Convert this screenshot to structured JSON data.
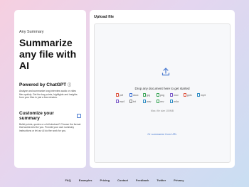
{
  "left": {
    "brand": "Any Summary",
    "hero": "Summarize any file with AI",
    "powered": {
      "title": "Powered by ChatGPT",
      "desc": "Analyze and summarize long interview audio or video files quickly. Get the key points, highlights and insights from your files in just a few minutes."
    },
    "customize": {
      "title": "Customize your summary",
      "desc": "Bullet points, quotes or a full abstract? Choose the format that works best for you. Provide your own summary instructions or let our AI do the work for you."
    }
  },
  "upload": {
    "title": "Upload file",
    "drop_text": "Drop any document here to get started",
    "max_size": "Max. file size 100MB",
    "url_link": "Or summarize from URL",
    "formats": [
      {
        "label": "pdf",
        "color": "#e0533d"
      },
      {
        "label": "docx",
        "color": "#3b6fd4"
      },
      {
        "label": "jpg",
        "color": "#3aa657"
      },
      {
        "label": "png",
        "color": "#3aa657"
      },
      {
        "label": "mov",
        "color": "#7a57c9"
      },
      {
        "label": "pptx",
        "color": "#e0533d"
      },
      {
        "label": "mp3",
        "color": "#2b8cc4"
      },
      {
        "label": "mp4",
        "color": "#7a57c9"
      },
      {
        "label": "txt",
        "color": "#888888"
      },
      {
        "label": "wav",
        "color": "#2b8cc4"
      },
      {
        "label": "csv",
        "color": "#3aa657"
      },
      {
        "label": "m4a",
        "color": "#2b8cc4"
      }
    ]
  },
  "footer": {
    "links": [
      "FAQ",
      "Examples",
      "Pricing",
      "Contact",
      "Feedback",
      "Twitter",
      "Privacy"
    ]
  },
  "colors": {
    "accent": "#4a7bd0",
    "background_start": "#f6cfe0",
    "background_end": "#c9def2"
  }
}
